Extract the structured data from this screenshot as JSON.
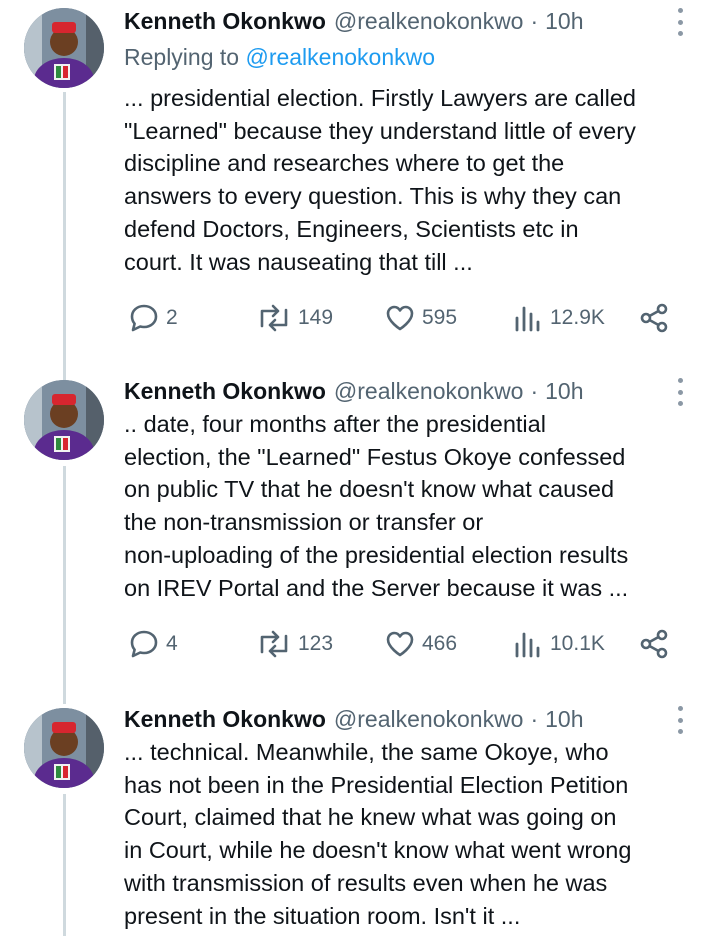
{
  "colors": {
    "accent": "#1d9bf0",
    "secondary_text": "#536471",
    "thread_line": "#cfd9de"
  },
  "tweets": [
    {
      "author_name": "Kenneth Okonkwo",
      "handle": "@realkenokonkwo",
      "separator": "·",
      "time": "10h",
      "replying_prefix": "Replying to",
      "replying_to": "@realkenokonkwo",
      "lines": [
        "... presidential election. Firstly Lawyers are called",
        "\"Learned\" because they understand little of every",
        "discipline and researches where to get the",
        "answers to every question. This is why they can",
        "defend Doctors, Engineers, Scientists etc in",
        "court. It was nauseating that till ..."
      ],
      "replies": "2",
      "reposts": "149",
      "likes": "595",
      "views": "12.9K"
    },
    {
      "author_name": "Kenneth Okonkwo",
      "handle": "@realkenokonkwo",
      "separator": "·",
      "time": "10h",
      "lines": [
        ".. date, four months after the presidential",
        "election, the \"Learned\" Festus Okoye confessed",
        "on public TV that he doesn't know what caused",
        "the non-transmission or transfer or",
        "non-uploading of the presidential election results",
        "on IREV Portal and the Server because it was ..."
      ],
      "replies": "4",
      "reposts": "123",
      "likes": "466",
      "views": "10.1K"
    },
    {
      "author_name": "Kenneth Okonkwo",
      "handle": "@realkenokonkwo",
      "separator": "·",
      "time": "10h",
      "lines": [
        "... technical. Meanwhile, the same Okoye, who",
        "has not been in the Presidential Election Petition",
        "Court, claimed that he knew what was going on",
        "in Court, while he doesn't know what went wrong",
        "with transmission of results even when he was",
        "present in the situation room. Isn't it ..."
      ]
    }
  ]
}
